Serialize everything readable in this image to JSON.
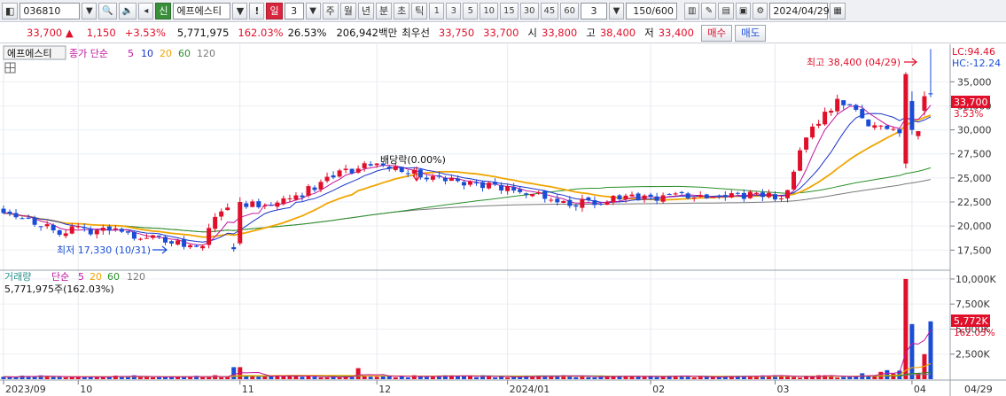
{
  "toolbar": {
    "code": "036810",
    "credit_badge": "신",
    "name": "에프에스티",
    "alert_badge": "!",
    "day_label": "일",
    "day_count": "3",
    "periods": [
      "주",
      "월",
      "년",
      "분",
      "초",
      "틱"
    ],
    "minute_options": [
      "1",
      "3",
      "5",
      "10",
      "15",
      "30",
      "45",
      "60"
    ],
    "tick_count": "3",
    "bar_count": "150/600",
    "date": "2024/04/29"
  },
  "quote": {
    "price": "33,700",
    "change_arrow": "▲",
    "change": "1,150",
    "change_pct": "+3.53%",
    "volume": "5,771,975",
    "volume_ratio": "162.03%",
    "turnover": "26.53%",
    "amount": "206,942백만",
    "best_ask_label": "최우선",
    "best_ask": "33,750",
    "best_bid": "33,700",
    "open_label": "시",
    "open": "33,800",
    "high_label": "고",
    "high": "38,400",
    "low_label": "저",
    "low": "33,400",
    "buy_label": "매수",
    "sell_label": "매도"
  },
  "chart_data": {
    "type": "candlestick",
    "price_legend": {
      "name": "에프에스티",
      "ma_label": "종가 단순",
      "ma_periods": [
        "5",
        "10",
        "20",
        "60",
        "120"
      ]
    },
    "volume_legend": {
      "label": "거래량",
      "ma_label": "단순",
      "ma_periods": [
        "5",
        "20",
        "60",
        "120"
      ]
    },
    "volume_value_text": "5,771,975주(162.03%)",
    "lc_text": "LC:94.46",
    "hc_text": "HC:-12.24",
    "high_annotation": "최고 38,400 (04/29)",
    "low_annotation": "최저 17,330 (10/31)",
    "dividend_annotation": "배당락(0.00%)",
    "current_price_tag": "33,700",
    "current_pct_tag": "3.53%",
    "current_volume_tag": "5,772K",
    "current_volume_pct_tag": "162.03%",
    "price_ticks": [
      "35,000",
      "32,500",
      "30,000",
      "27,500",
      "25,000",
      "22,500",
      "20,000",
      "17,500"
    ],
    "price_tick_values": [
      35000,
      32500,
      30000,
      27500,
      25000,
      22500,
      20000,
      17500
    ],
    "price_range": [
      15500,
      38900
    ],
    "volume_ticks": [
      "10,000K",
      "7,500K",
      "5,000K",
      "2,500K"
    ],
    "volume_tick_values": [
      10000,
      7500,
      5000,
      2500
    ],
    "volume_range": [
      0,
      10700
    ],
    "x_labels": [
      "2023/09",
      "10",
      "11",
      "12",
      "2024/01",
      "02",
      "03",
      "04",
      "04/29"
    ],
    "x_label_bar_index": [
      0,
      12,
      38,
      60,
      81,
      104,
      124,
      146,
      149
    ],
    "up_color": "#e0102b",
    "down_color": "#1a4dd6",
    "ma_colors": {
      "5": "#c0149e",
      "10": "#1a35c9",
      "20": "#f0a500",
      "60": "#2a8f2a",
      "120": "#7a7a7a"
    }
  }
}
